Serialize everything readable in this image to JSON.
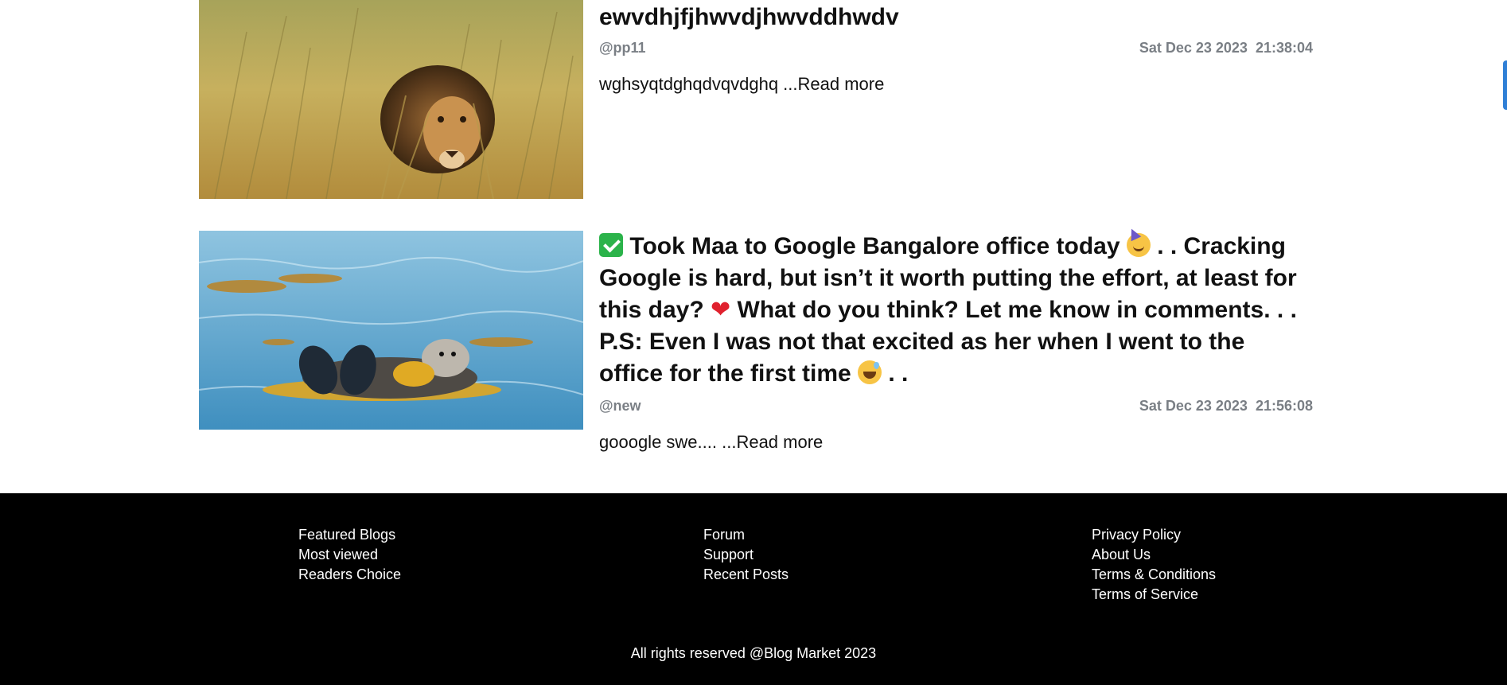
{
  "posts": [
    {
      "image": "lion-in-grass",
      "title": "ewvdhjfjhwvdjhwvddhwdv",
      "author": "@pp11",
      "date": "Sat Dec 23 2023",
      "time": "21:38:04",
      "excerpt": "wghsyqtdghqdvqvdghq ",
      "read_more": "...Read more"
    },
    {
      "image": "sea-otter-in-kelp",
      "title_parts": {
        "p1": "Took Maa to Google Bangalore office today",
        "p2": ". . Cracking Google is hard, but isn’t it worth putting the effort, at least for this day?",
        "p3": "What do you think? Let me know in comments. . . P.S: Even I was not that excited as her when I went to the office for the first time",
        "p4": ". ."
      },
      "icons": [
        "check-mark-icon",
        "party-face-icon",
        "red-heart-icon",
        "grinning-sweat-icon"
      ],
      "author": "@new",
      "date": "Sat Dec 23 2023",
      "time": "21:56:08",
      "excerpt": "gooogle swe.... ",
      "read_more": "...Read more"
    }
  ],
  "footer": {
    "col1": [
      "Featured Blogs",
      "Most viewed",
      "Readers Choice"
    ],
    "col2": [
      "Forum",
      "Support",
      "Recent Posts"
    ],
    "col3": [
      "Privacy Policy",
      "About Us",
      "Terms & Conditions",
      "Terms of Service"
    ],
    "copyright": "All rights reserved @Blog Market 2023"
  },
  "colors": {
    "footer_bg": "#000000",
    "meta_text": "#7a7f85",
    "scroll_tab": "#2f7fd6"
  }
}
